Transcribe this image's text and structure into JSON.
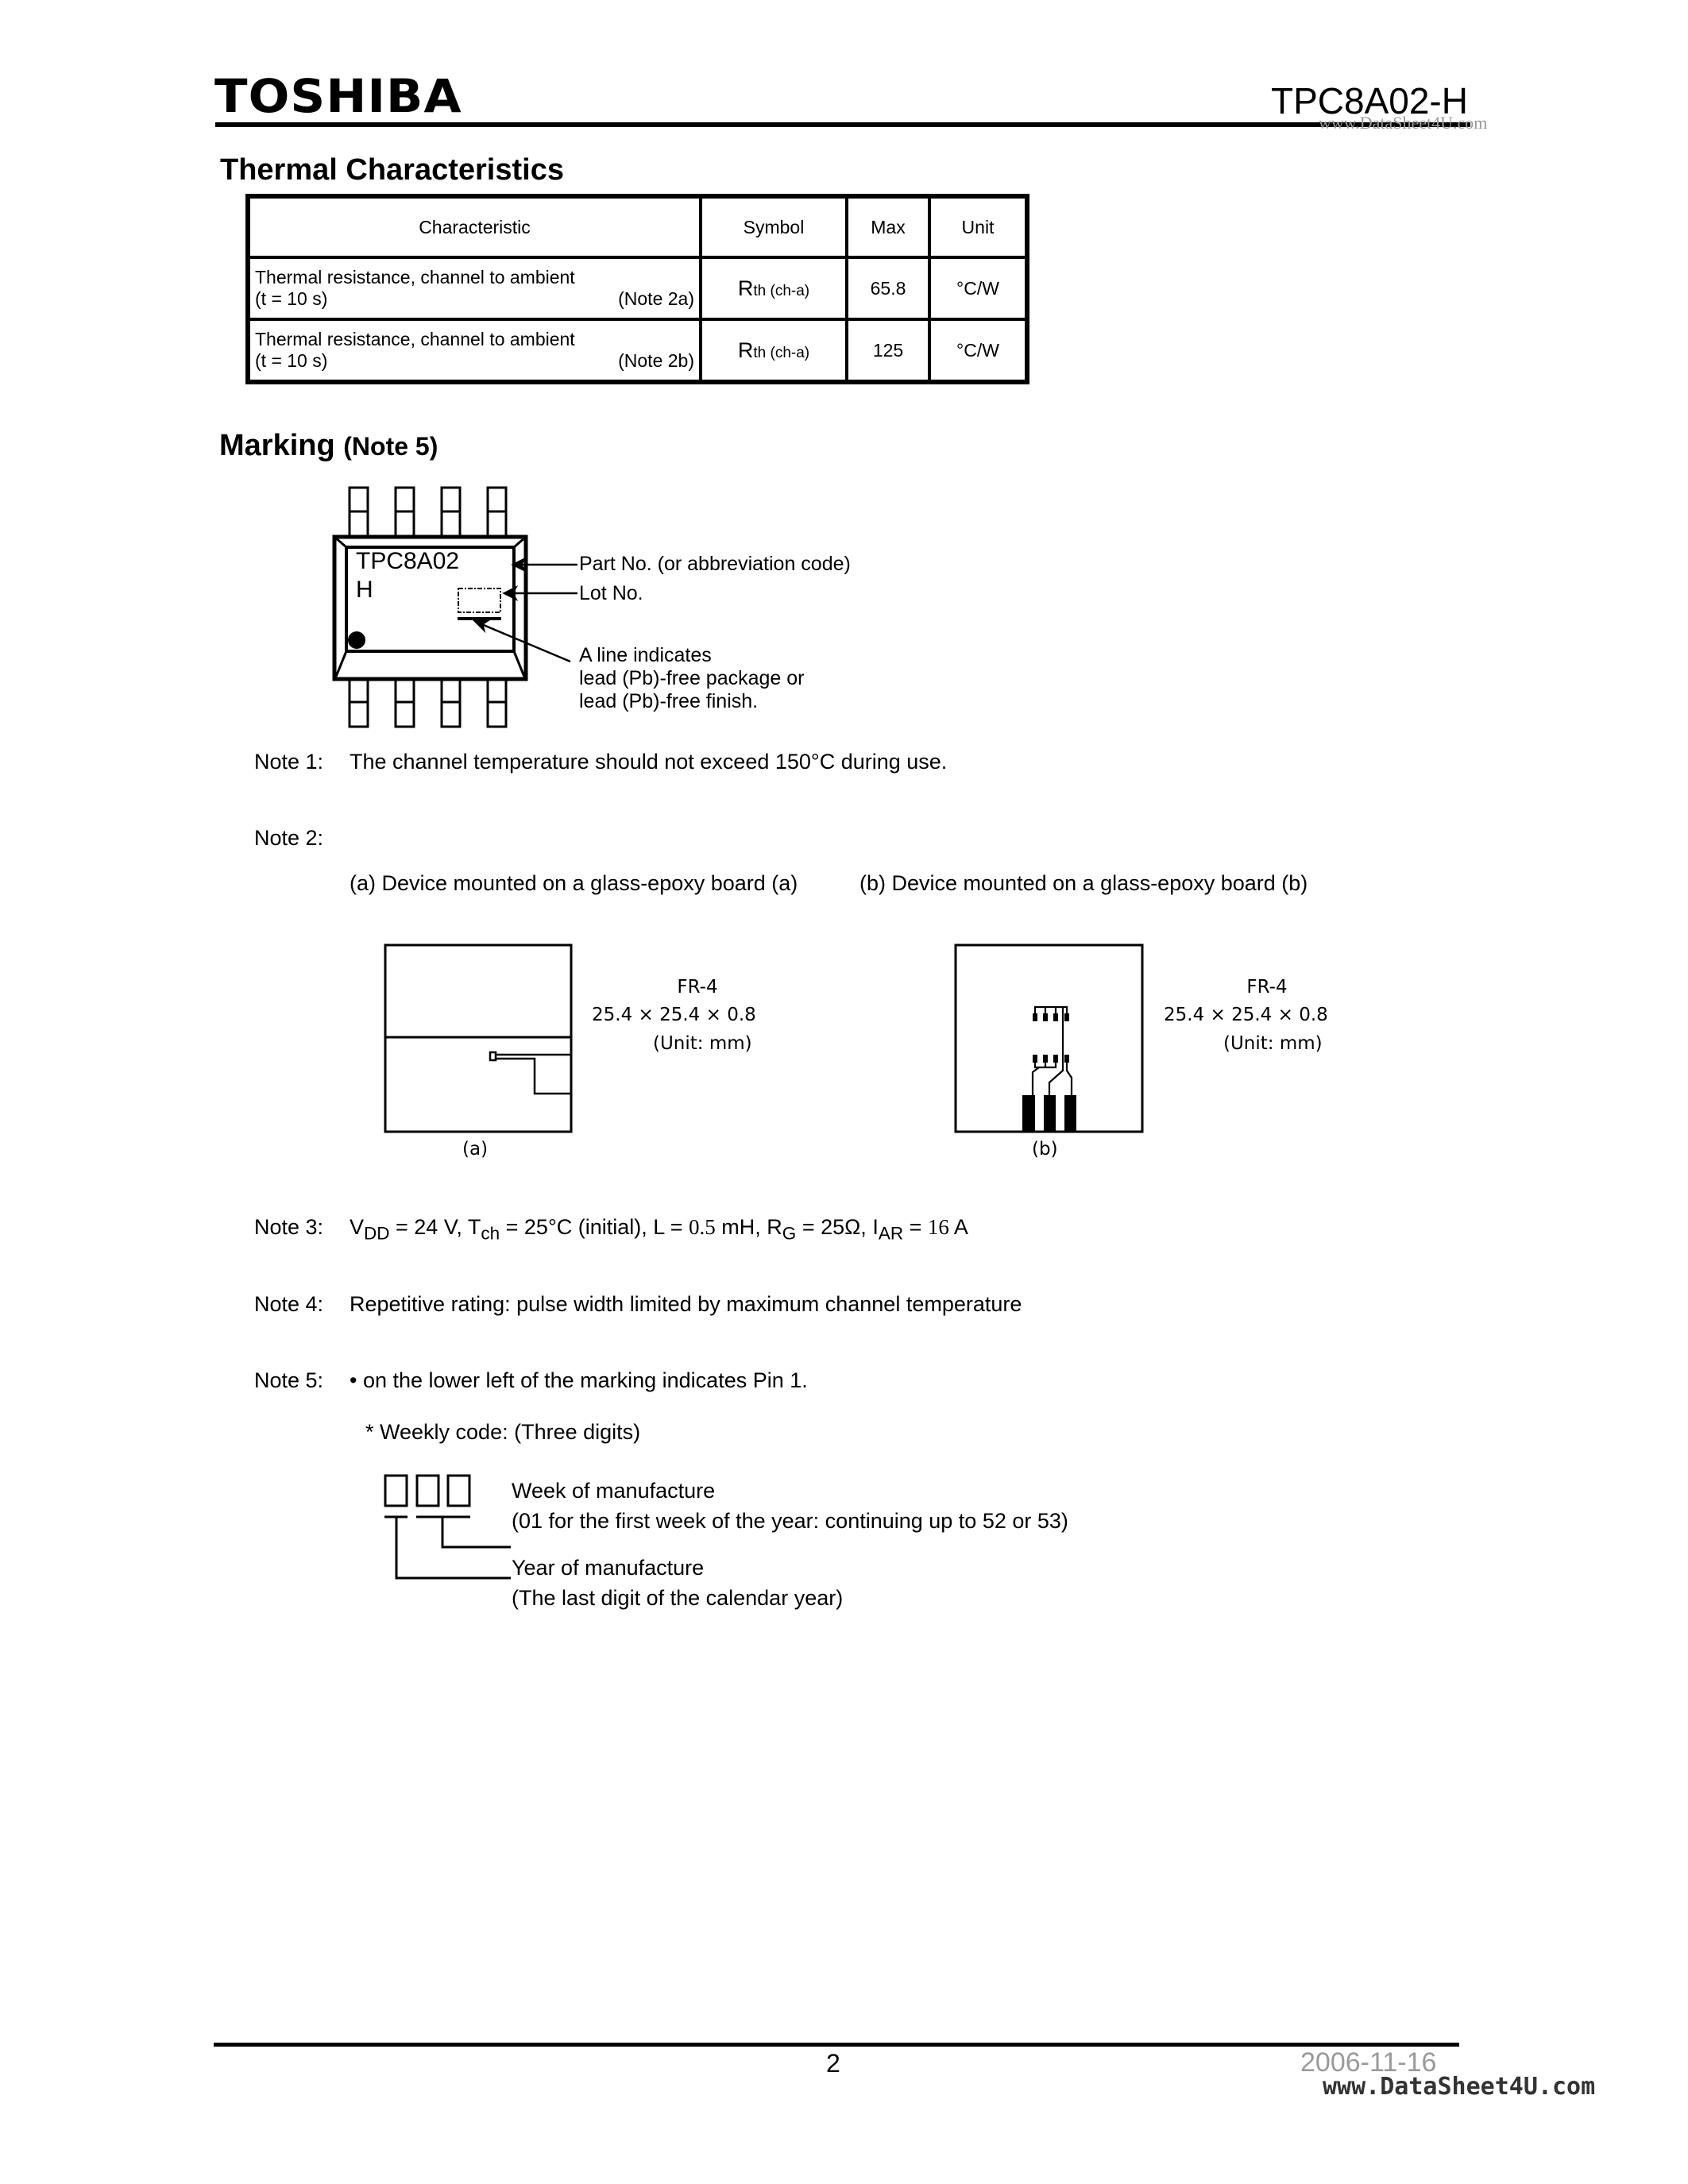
{
  "header": {
    "brand": "TOSHIBA",
    "part_number": "TPC8A02-H",
    "watermark": "www.DataSheet4U.com"
  },
  "thermal": {
    "title": "Thermal Characteristics",
    "columns": [
      "Characteristic",
      "Symbol",
      "Max",
      "Unit"
    ],
    "rows": [
      {
        "characteristic": "Thermal resistance, channel to ambient",
        "condition": "(t = 10 s)",
        "note": "(Note 2a)",
        "symbol_main": "R",
        "symbol_sub": "th (ch-a)",
        "max": "65.8",
        "unit": "°C/W"
      },
      {
        "characteristic": "Thermal resistance, channel to ambient",
        "condition": "(t = 10 s)",
        "note": "(Note 2b)",
        "symbol_main": "R",
        "symbol_sub": "th (ch-a)",
        "max": "125",
        "unit": "°C/W"
      }
    ]
  },
  "marking": {
    "title": "Marking",
    "title_note": "(Note 5)",
    "chip_line1": "TPC8A02",
    "chip_line2": "H",
    "callouts": {
      "part_no": "Part No. (or abbreviation code)",
      "lot_no": "Lot No.",
      "line1": "A line indicates",
      "line2": "lead (Pb)-free package or",
      "line3": "lead (Pb)-free finish."
    }
  },
  "notes": {
    "note1": {
      "label": "Note 1:",
      "text": "The channel temperature should not exceed 150°C during use."
    },
    "note2": {
      "label": "Note 2:",
      "board_a_caption": "(a) Device mounted on a glass-epoxy board (a)",
      "board_b_caption": "(b) Device mounted on a glass-epoxy board (b)",
      "board_a": {
        "material": "FR-4",
        "dims": "25.4 × 25.4 × 0.8",
        "unit": "(Unit: mm)",
        "label": "(a)"
      },
      "board_b": {
        "material": "FR-4",
        "dims": "25.4 × 25.4 × 0.8",
        "unit": "(Unit: mm)",
        "label": "(b)"
      }
    },
    "note3": {
      "label": "Note 3:",
      "vdd_sym": "V",
      "vdd_sub": "DD",
      "vdd_val": " = 24 V, ",
      "tch_sym": "T",
      "tch_sub": "ch",
      "tch_val": " = 25°C (initial), L = ",
      "l_val": "0.5",
      "l_unit": " mH, ",
      "rg_sym": "R",
      "rg_sub": "G",
      "rg_val": " = 25Ω, ",
      "iar_sym": "I",
      "iar_sub": "AR",
      "iar_eq": " = ",
      "iar_val": "16",
      "iar_unit": " A"
    },
    "note4": {
      "label": "Note 4:",
      "text": "Repetitive rating: pulse width limited by maximum channel temperature"
    },
    "note5": {
      "label": "Note 5:",
      "bullet": "•",
      "text": " on the lower left of the marking indicates Pin 1.",
      "weekly_code": "* Weekly code:  (Three digits)",
      "week_title": "Week of manufacture",
      "week_desc": "(01 for the first week of the year: continuing up to 52 or 53)",
      "year_title": "Year of manufacture",
      "year_desc": "(The last digit of the calendar year)"
    }
  },
  "footer": {
    "page": "2",
    "date": "2006-11-16",
    "watermark": "www.DataSheet4U.com"
  }
}
